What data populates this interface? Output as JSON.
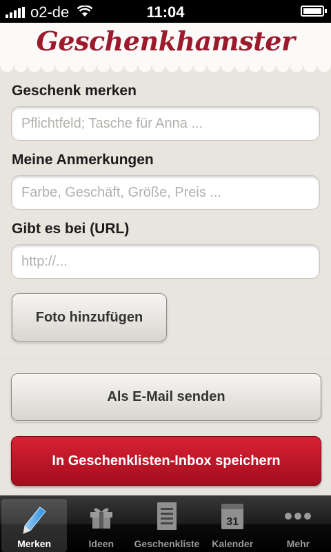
{
  "status_bar": {
    "carrier": "o2-de",
    "time": "11:04"
  },
  "header": {
    "title": "Geschenkhamster"
  },
  "form": {
    "gift_label": "Geschenk merken",
    "gift_placeholder": "Pflichtfeld; Tasche für Anna ...",
    "notes_label": "Meine Anmerkungen",
    "notes_placeholder": "Farbe, Geschäft, Größe, Preis ...",
    "url_label": "Gibt es bei (URL)",
    "url_placeholder": "http://...",
    "photo_button": "Foto hinzufügen",
    "email_button": "Als E-Mail senden",
    "save_button": "In Geschenklisten-Inbox speichern"
  },
  "tabs": [
    {
      "label": "Merken",
      "icon": "pencil-icon",
      "active": true
    },
    {
      "label": "Ideen",
      "icon": "gift-icon",
      "active": false
    },
    {
      "label": "Geschenkliste",
      "icon": "list-icon",
      "active": false
    },
    {
      "label": "Kalender",
      "icon": "calendar-icon",
      "active": false,
      "badge": "31"
    },
    {
      "label": "Mehr",
      "icon": "more-icon",
      "active": false
    }
  ],
  "colors": {
    "brand": "#9c1a2c",
    "save_button": "#c0172a",
    "background": "#e8e4de"
  }
}
